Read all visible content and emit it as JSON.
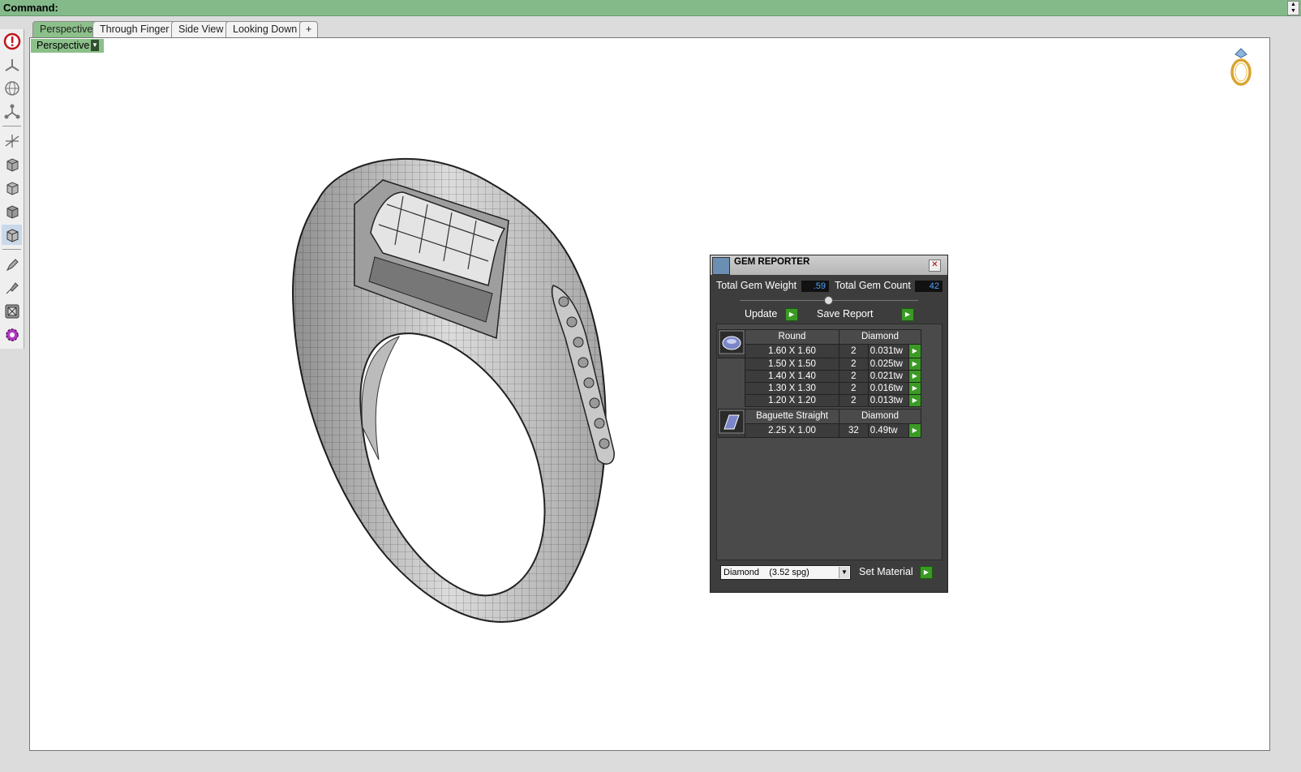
{
  "command_bar": {
    "label": "Command:"
  },
  "tabs": [
    {
      "label": "Perspective",
      "active": true
    },
    {
      "label": "Through Finger",
      "active": false
    },
    {
      "label": "Side View",
      "active": false
    },
    {
      "label": "Looking Down",
      "active": false
    },
    {
      "label": "+",
      "active": false
    }
  ],
  "viewport": {
    "title": "Perspective"
  },
  "toolbar": {
    "icons": [
      "stop-icon",
      "axis-icon",
      "globe-icon",
      "node-icon",
      "snap-axis-icon",
      "cube-shaded-icon",
      "cube-wire-icon",
      "cube-flat-icon",
      "cube-render-icon",
      "pen-icon",
      "brush-icon",
      "frame-icon",
      "gear-plugin-icon"
    ]
  },
  "gem_reporter": {
    "title": "GEM REPORTER",
    "total_weight_label": "Total Gem Weight",
    "total_weight_value": ".59",
    "total_count_label": "Total Gem Count",
    "total_count_value": "42",
    "update_label": "Update",
    "save_report_label": "Save Report",
    "groups": [
      {
        "shape": "Round",
        "material": "Diamond",
        "icon": "round-gem-icon",
        "rows": [
          {
            "size": "1.60 X 1.60",
            "count": "2",
            "weight": "0.031tw"
          },
          {
            "size": "1.50 X 1.50",
            "count": "2",
            "weight": "0.025tw"
          },
          {
            "size": "1.40 X 1.40",
            "count": "2",
            "weight": "0.021tw"
          },
          {
            "size": "1.30 X 1.30",
            "count": "2",
            "weight": "0.016tw"
          },
          {
            "size": "1.20 X 1.20",
            "count": "2",
            "weight": "0.013tw"
          }
        ]
      },
      {
        "shape": "Baguette Straight",
        "material": "Diamond",
        "icon": "baguette-gem-icon",
        "rows": [
          {
            "size": "2.25 X 1.00",
            "count": "32",
            "weight": "0.49tw"
          }
        ]
      }
    ],
    "material_select": "Diamond    (3.52 spg)",
    "set_material_label": "Set Material"
  },
  "colors": {
    "command_bar": "#84b98a",
    "active_tab": "#8cc08a",
    "panel_bg": "#3d3d3d",
    "value_text": "#4ea3ff",
    "go_button": "#3a9a24"
  }
}
